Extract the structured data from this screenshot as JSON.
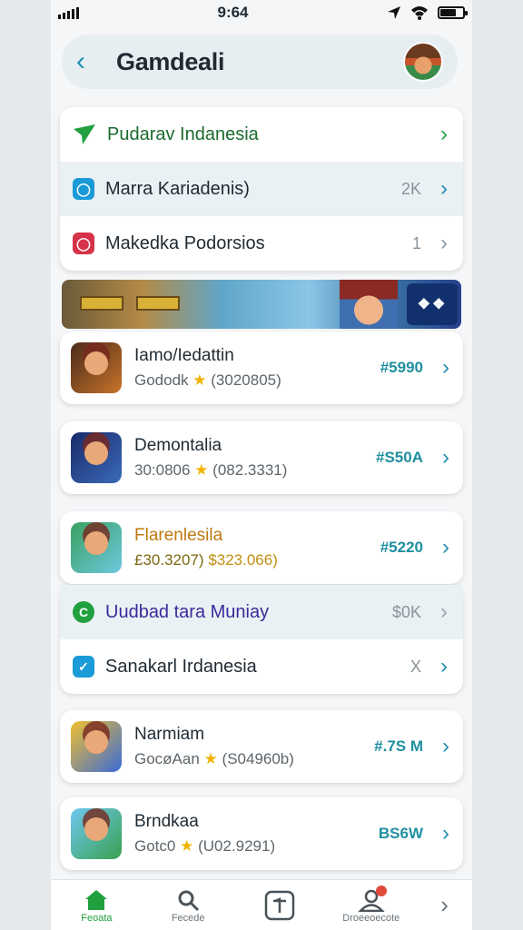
{
  "status_bar": {
    "time": "9:64"
  },
  "header": {
    "title": "Gamdeali"
  },
  "menu": [
    {
      "label": "Pudarav Indanesia",
      "count": "",
      "color": "#21a040",
      "icon": "send-icon"
    },
    {
      "label": "Marra Kariadenis)",
      "count": "2K",
      "color": "#1a9ad6",
      "icon": "tag-icon"
    },
    {
      "label": "Makedka Podorsios",
      "count": "1",
      "color": "#d6334a",
      "icon": "ring-icon"
    }
  ],
  "games_a": [
    {
      "name": "Iamo/Iedattin",
      "sub": "Gododk",
      "rating": "(3020805)",
      "price": "#5990",
      "thumb": "linear-gradient(135deg,#4a2a1a,#c8742a)"
    },
    {
      "name": "Demontalia",
      "sub": "30:0806",
      "rating": "(082.3331)",
      "price": "#S50A",
      "thumb": "linear-gradient(135deg,#1a2a6a,#3a6ab8)"
    },
    {
      "name": "Flarenlesila",
      "sub": "£30.3207)",
      "rating": "$323.066)",
      "price": "#5220",
      "thumb": "linear-gradient(135deg,#3aa060,#6ec8e0)"
    }
  ],
  "menu2": [
    {
      "label": "Uudbad tara Muniay",
      "count": "$0K",
      "color": "#21a040",
      "icon": "refresh-icon"
    },
    {
      "label": "Sanakarl Irdanesia",
      "count": "X",
      "color": "#1a9ad6",
      "icon": "check-icon"
    }
  ],
  "games_b": [
    {
      "name": "Narmiam",
      "sub": "GocøAan",
      "rating": "(S04960b)",
      "price": "#.7S M",
      "thumb": "linear-gradient(135deg,#f0c030,#3a6ad6)"
    },
    {
      "name": "Brndkaa",
      "sub": "Gotc0",
      "rating": "(U02.9291)",
      "price": "BS6W",
      "thumb": "linear-gradient(135deg,#6ec8f0,#3aa050)"
    }
  ],
  "tabs": [
    {
      "label": "Feoata"
    },
    {
      "label": "Fecede"
    },
    {
      "label": ""
    },
    {
      "label": "Droeeoecote"
    }
  ]
}
